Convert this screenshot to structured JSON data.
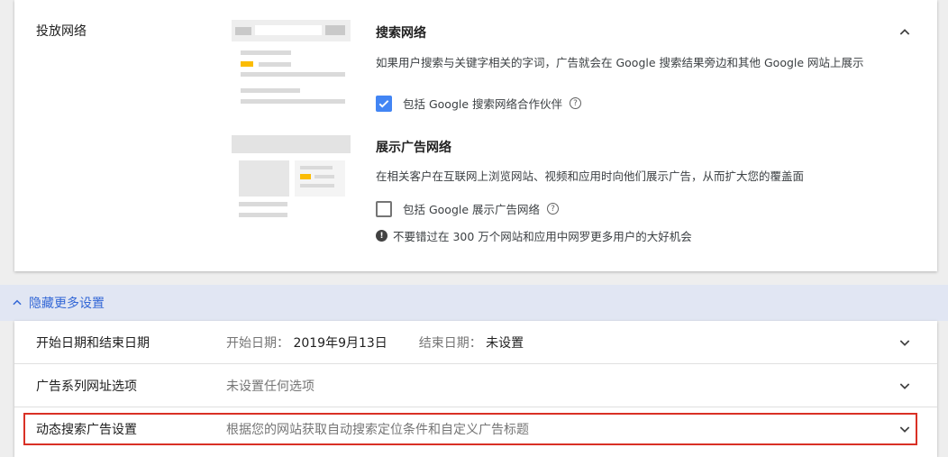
{
  "networks": {
    "section_label": "投放网络",
    "search": {
      "title": "搜索网络",
      "description": "如果用户搜索与关键字相关的字词，广告就会在 Google 搜索结果旁边和其他 Google 网站上展示",
      "checkbox_label": "包括 Google 搜索网络合作伙伴",
      "checked": true
    },
    "display": {
      "title": "展示广告网络",
      "description": "在相关客户在互联网上浏览网站、视频和应用时向他们展示广告，从而扩大您的覆盖面",
      "checkbox_label": "包括 Google 展示广告网络",
      "checked": false,
      "info_text": "不要错过在 300 万个网站和应用中网罗更多用户的大好机会"
    }
  },
  "more_settings": {
    "toggle_label": "隐藏更多设置"
  },
  "settings_rows": {
    "dates": {
      "label": "开始日期和结束日期",
      "start_label": "开始日期：",
      "start_value": "2019年9月13日",
      "end_label": "结束日期：",
      "end_value": "未设置"
    },
    "url_options": {
      "label": "广告系列网址选项",
      "value": "未设置任何选项"
    },
    "dsa": {
      "label": "动态搜索广告设置",
      "value": "根据您的网站获取自动搜索定位条件和自定义广告标题"
    }
  },
  "colors": {
    "accent": "#4285f4",
    "link": "#3367d6",
    "highlight": "#d93025",
    "ad_marker": "#fbbc04"
  }
}
